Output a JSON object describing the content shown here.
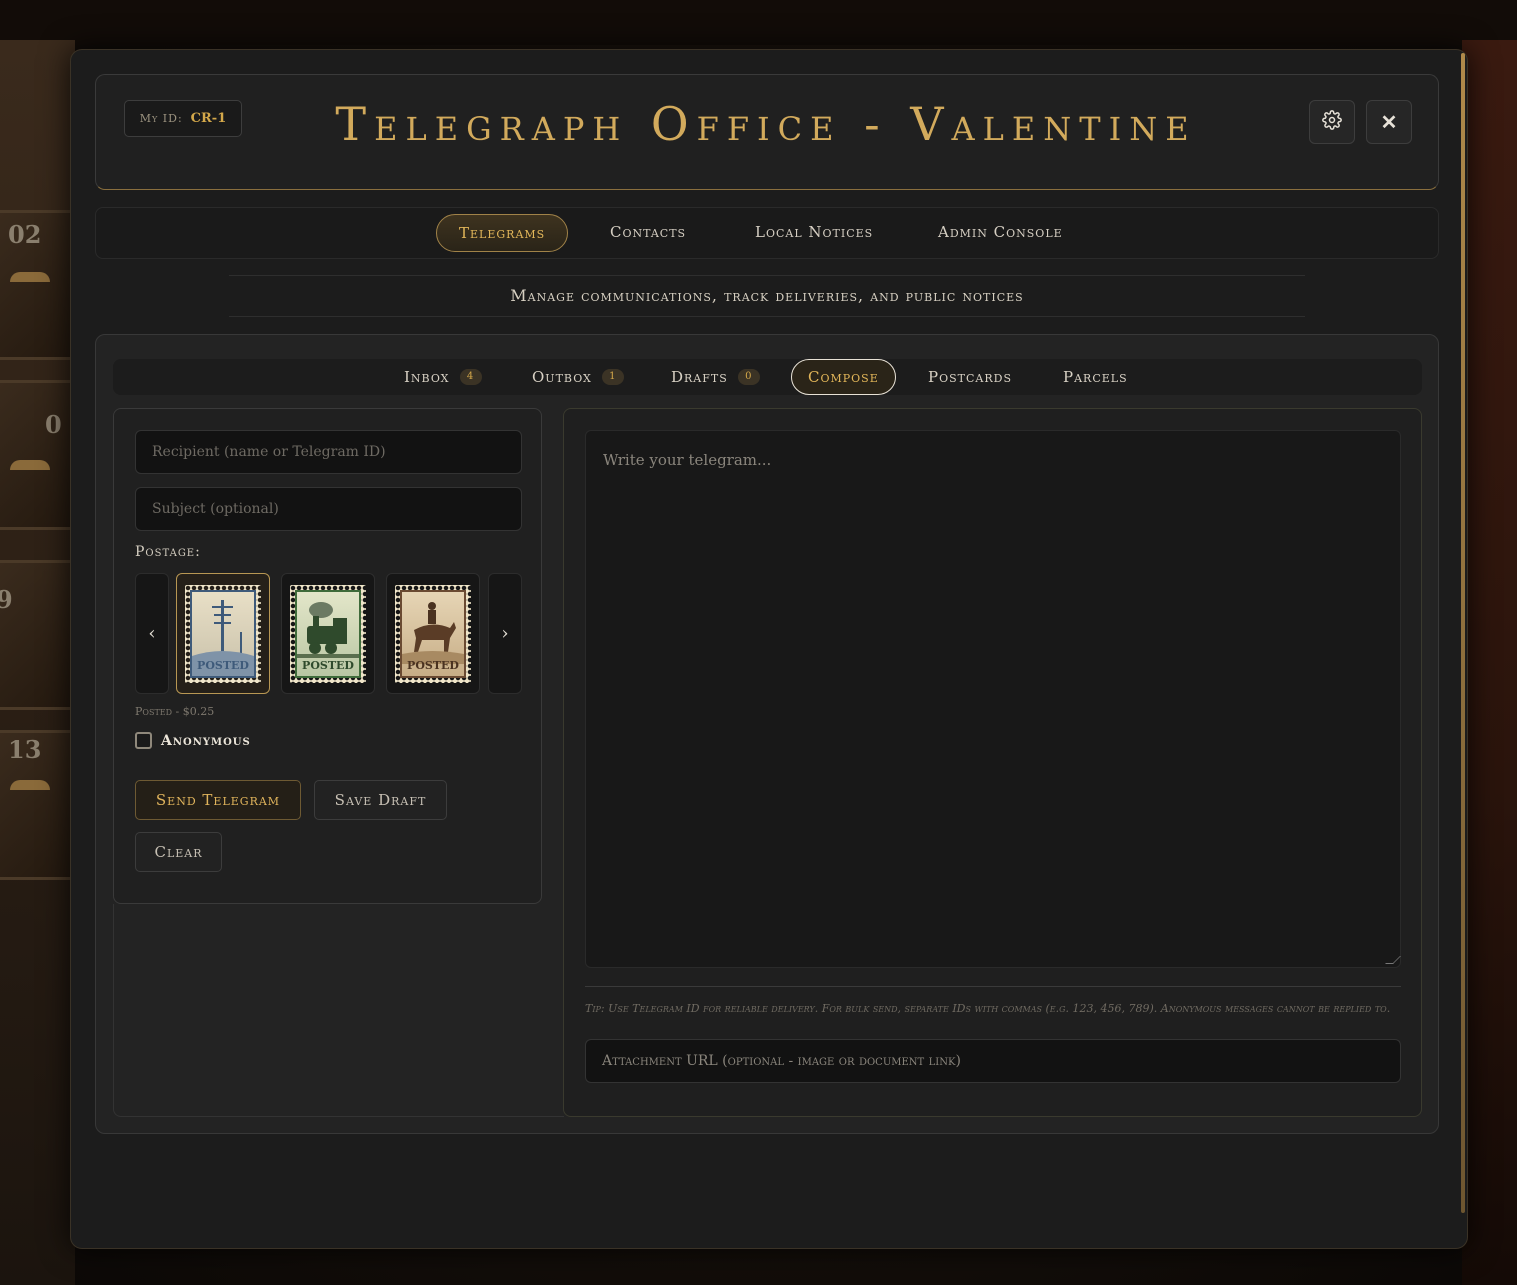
{
  "background": {
    "box_numbers": [
      "02",
      "0",
      "9",
      "13"
    ]
  },
  "header": {
    "my_id_label": "My ID:",
    "my_id_value": "CR-1",
    "title": "Telegraph Office - Valentine",
    "settings_icon": "gear-icon",
    "close_icon": "close-icon",
    "close_glyph": "✕"
  },
  "topnav": {
    "items": [
      {
        "label": "Telegrams",
        "active": true
      },
      {
        "label": "Contacts",
        "active": false
      },
      {
        "label": "Local Notices",
        "active": false
      },
      {
        "label": "Admin Console",
        "active": false
      }
    ]
  },
  "subtitle": "Manage communications, track deliveries, and public notices",
  "subnav": {
    "tabs": [
      {
        "label": "Inbox",
        "badge": "4"
      },
      {
        "label": "Outbox",
        "badge": "1"
      },
      {
        "label": "Drafts",
        "badge": "0"
      },
      {
        "label": "Compose",
        "badge": null,
        "active": true
      },
      {
        "label": "Postcards",
        "badge": null
      },
      {
        "label": "Parcels",
        "badge": null
      }
    ]
  },
  "compose": {
    "recipient_placeholder": "Recipient (name or Telegram ID)",
    "subject_placeholder": "Subject (optional)",
    "postage_label": "Postage:",
    "prev_glyph": "‹",
    "next_glyph": "›",
    "stamps": [
      {
        "name": "telegraph-pole-stamp",
        "text": "POSTED",
        "color": "#3e5a7a",
        "selected": true
      },
      {
        "name": "locomotive-stamp",
        "text": "POSTED",
        "color": "#3f6b3a",
        "selected": false
      },
      {
        "name": "horse-rider-stamp",
        "text": "POSTED",
        "color": "#6a4a32",
        "selected": false
      }
    ],
    "stamp_meta": "Posted - $0.25",
    "anonymous_label": "Anonymous",
    "send_label": "Send Telegram",
    "save_label": "Save Draft",
    "clear_label": "Clear",
    "message_placeholder": "Write your telegram...",
    "tip": "Tip: Use Telegram ID for reliable delivery. For bulk send, separate IDs with commas (e.g. 123, 456, 789). Anonymous messages cannot be replied to.",
    "attachment_placeholder": "Attachment URL (optional - image or document link)"
  },
  "colors": {
    "accent": "#d2aa5c",
    "panel": "#232323",
    "window": "#1c1c1c"
  }
}
